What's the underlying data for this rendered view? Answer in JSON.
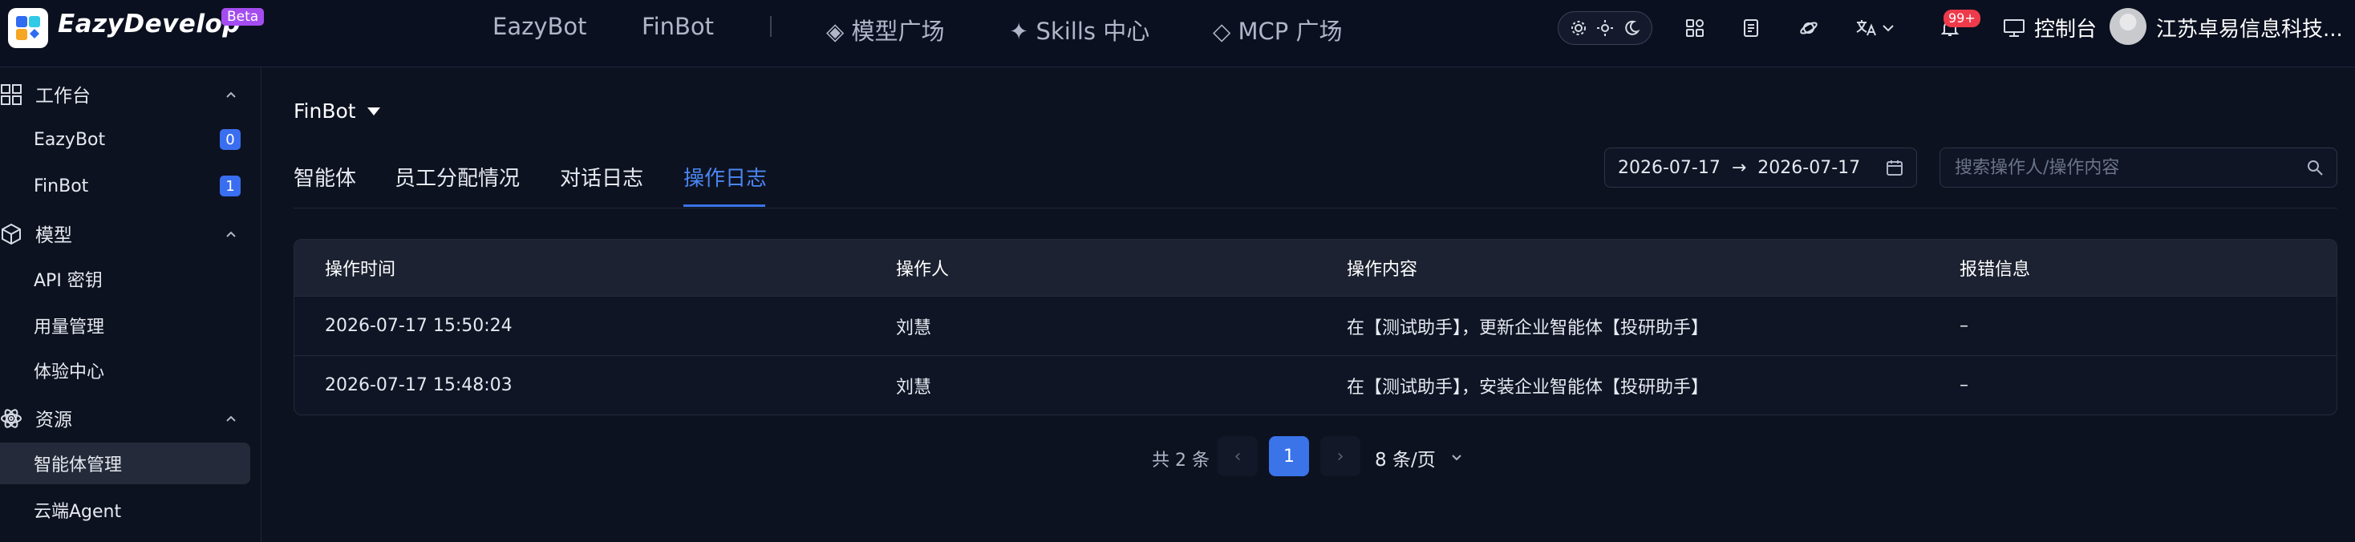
{
  "header": {
    "brand": "EazyDevelop",
    "beta": "Beta",
    "nav": [
      "EazyBot",
      "FinBot"
    ],
    "features": [
      {
        "icon": "diamond-icon",
        "label": "◈ 模型广场"
      },
      {
        "icon": "sparkle-icon",
        "label": "✦ Skills 中心"
      },
      {
        "icon": "diamond-outline-icon",
        "label": "◇ MCP 广场"
      }
    ],
    "notifications_badge": "99+",
    "console_label": "控制台",
    "org_name": "江苏卓易信息科技..."
  },
  "sidebar": {
    "groups": [
      {
        "label": "工作台",
        "icon": "grid-icon",
        "items": [
          {
            "label": "EazyBot",
            "count": "0"
          },
          {
            "label": "FinBot",
            "count": "1"
          }
        ]
      },
      {
        "label": "模型",
        "icon": "cube-icon",
        "items": [
          {
            "label": "API 密钥"
          },
          {
            "label": "用量管理"
          },
          {
            "label": "体验中心"
          }
        ]
      },
      {
        "label": "资源",
        "icon": "atom-icon",
        "items": [
          {
            "label": "智能体管理"
          },
          {
            "label": "云端Agent"
          }
        ]
      }
    ],
    "active_item": "智能体管理"
  },
  "main": {
    "bot_select": "FinBot",
    "tabs": [
      "智能体",
      "员工分配情况",
      "对话日志",
      "操作日志"
    ],
    "active_tab": "操作日志",
    "date_start": "2026-07-17",
    "date_end": "2026-07-17",
    "date_arrow": "→",
    "search_placeholder": "搜索操作人/操作内容",
    "table": {
      "columns": [
        "操作时间",
        "操作人",
        "操作内容",
        "报错信息"
      ],
      "rows": [
        [
          "2026-07-17 15:50:24",
          "刘慧",
          "在【测试助手】，更新企业智能体【投研助手】",
          "–"
        ],
        [
          "2026-07-17 15:48:03",
          "刘慧",
          "在【测试助手】，安装企业智能体【投研助手】",
          "–"
        ]
      ]
    },
    "pagination": {
      "total": "共 2 条",
      "current": "1",
      "page_size": "8 条/页",
      "prev": "‹",
      "next": "›"
    }
  },
  "colors": {
    "accent": "#3a74e8",
    "background": "#0d1220",
    "active_tab": "#4a86f2",
    "beta": "#a44cf0",
    "badge": "#ee3a4a"
  }
}
